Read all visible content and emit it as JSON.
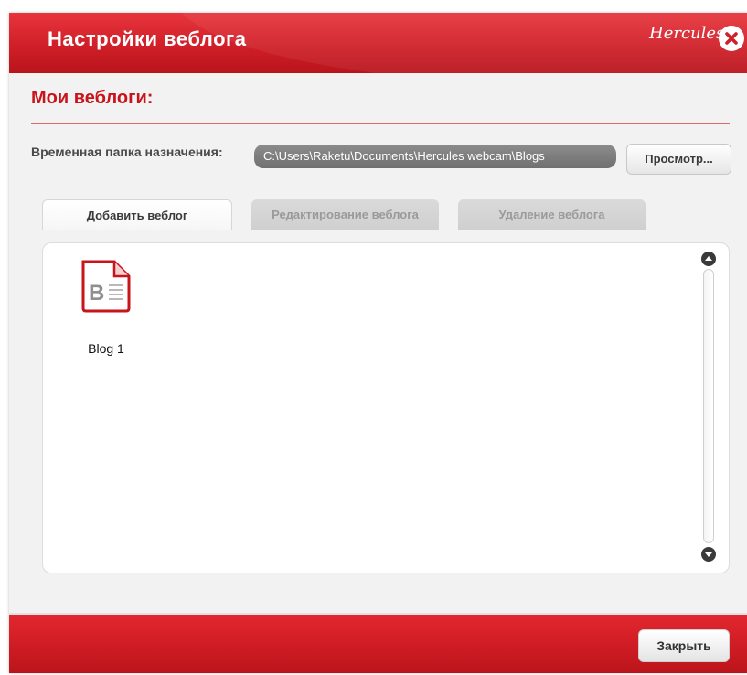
{
  "window": {
    "title": "Настройки веблога",
    "brand": "Hercules",
    "close_icon": "close-icon"
  },
  "section": {
    "title": "Мои веблоги:"
  },
  "folder": {
    "label": "Временная папка назначения:",
    "path": "C:\\Users\\Raketu\\Documents\\Hercules webcam\\Blogs",
    "browse_label": "Просмотр..."
  },
  "tabs": {
    "add": "Добавить веблог",
    "edit": "Редактирование веблога",
    "delete": "Удаление веблога"
  },
  "blogs": [
    {
      "label": "Blog 1",
      "icon": "blog-document-icon"
    }
  ],
  "footer": {
    "close_label": "Закрыть"
  },
  "colors": {
    "accent": "#d01f28",
    "section_title": "#c8141b"
  }
}
